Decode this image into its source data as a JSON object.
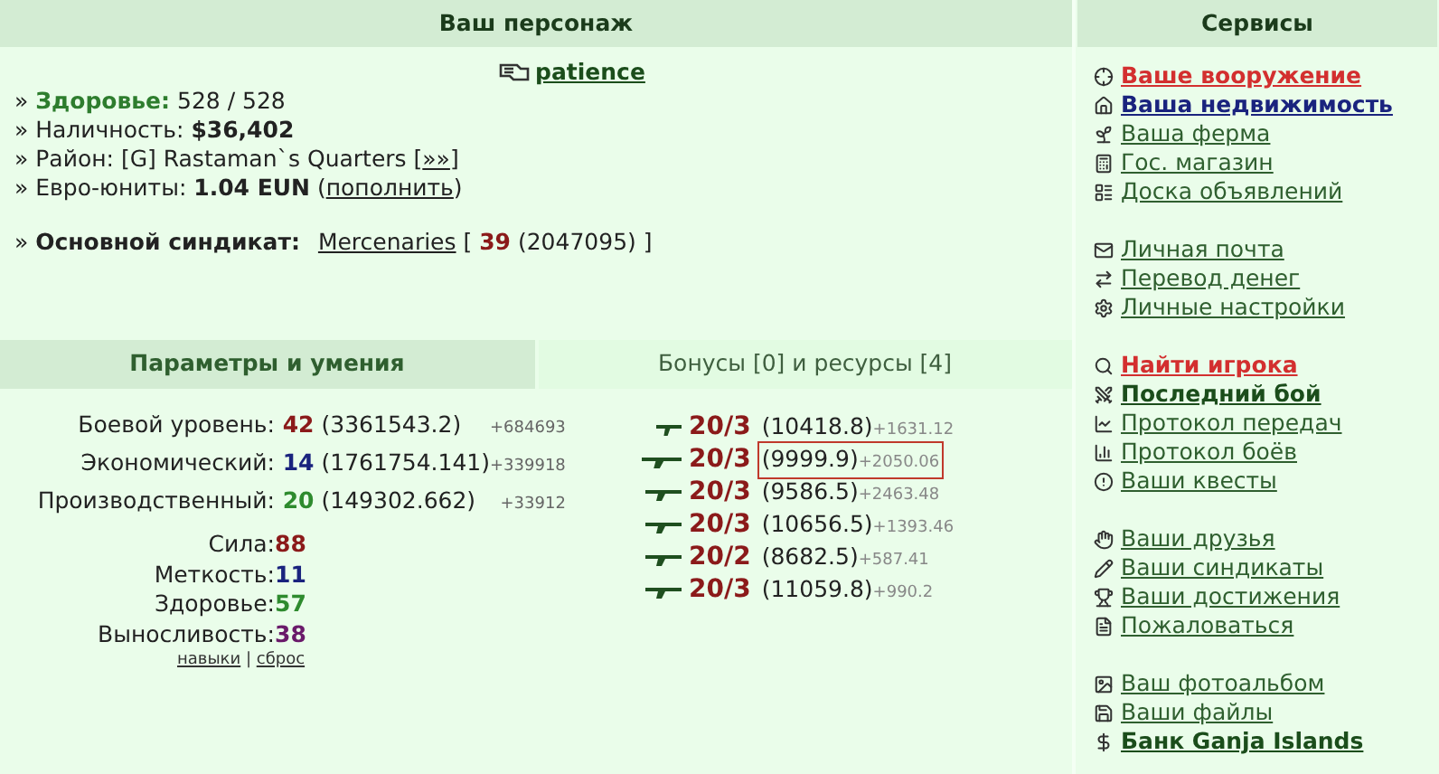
{
  "character": {
    "title": "Ваш персонаж",
    "name": "patience",
    "lines": [
      [
        {
          "text": "» "
        },
        {
          "text": "Здоровье:",
          "kind": "label"
        },
        {
          "text": " 528 / 528"
        }
      ],
      [
        {
          "text": "» Наличность: "
        },
        {
          "text": "$36,402",
          "kind": "bold"
        }
      ],
      [
        {
          "text": "» Район: [G] Rastaman`s Quarters ["
        },
        {
          "text": "»»",
          "kind": "link"
        },
        {
          "text": "]"
        }
      ],
      [
        {
          "text": "» Евро-юниты: "
        },
        {
          "text": "1.04 EUN",
          "kind": "bold"
        },
        {
          "text": " ("
        },
        {
          "text": "пополнить",
          "kind": "link"
        },
        {
          "text": ")"
        }
      ]
    ],
    "syndicate": [
      {
        "text": "» "
      },
      {
        "text": "Основной синдикат:",
        "kind": "bold"
      },
      {
        "text": "Mercenaries",
        "kind": "link"
      },
      {
        "text": " [ "
      },
      {
        "text": "39",
        "kind": "red"
      },
      {
        "text": " (2047095) ]"
      }
    ]
  },
  "tabs": [
    {
      "label": "Параметры и умения",
      "selected": true
    },
    {
      "label": "Бонусы [0] и ресурсы [4]",
      "selected": false
    }
  ],
  "skills": [
    {
      "label": "Боевой уровень:",
      "level": "42",
      "exp": "(3361543.2)",
      "gain": "+684693",
      "color": "#8b1a1a"
    },
    {
      "label": "Экономический:",
      "level": "14",
      "exp": "(1761754.141)",
      "gain": "+339918",
      "color": "#1a237e"
    },
    {
      "label": "Производственный:",
      "level": "20",
      "exp": "(149302.662)",
      "gain": "+33912",
      "color": "#2e8b2e"
    }
  ],
  "stats": [
    {
      "label": "Сила:",
      "value": "88",
      "color": "#8b1a1a"
    },
    {
      "label": "Меткость:",
      "value": "11",
      "color": "#1a237e"
    },
    {
      "label": "Здоровье:",
      "value": "57",
      "color": "#2e8b2e"
    },
    {
      "label": "Выносливость:",
      "value": "38",
      "color": "#6a1a6a"
    }
  ],
  "stat_links": [
    {
      "text": "навыки",
      "kind": "link"
    },
    {
      "text": " | "
    },
    {
      "text": "сброс",
      "kind": "link"
    }
  ],
  "weapons": [
    {
      "level": "20/3",
      "exp": "(10418.8)",
      "gain": "+1631.12",
      "highlighted": false
    },
    {
      "level": "20/3",
      "exp": "(9999.9)",
      "gain": "+2050.06",
      "highlighted": true
    },
    {
      "level": "20/3",
      "exp": "(9586.5)",
      "gain": "+2463.48",
      "highlighted": false
    },
    {
      "level": "20/3",
      "exp": "(10656.5)",
      "gain": "+1393.46",
      "highlighted": false
    },
    {
      "level": "20/2",
      "exp": "(8682.5)",
      "gain": "+587.41",
      "highlighted": false
    },
    {
      "level": "20/3",
      "exp": "(11059.8)",
      "gain": "+990.2",
      "highlighted": false
    }
  ],
  "services": {
    "title": "Сервисы",
    "groups": [
      [
        {
          "label": "Ваше вооружение",
          "kind": "alert"
        },
        {
          "label": "Ваша недвижимость",
          "kind": "strong"
        },
        {
          "label": "Ваша ферма",
          "kind": "normal"
        },
        {
          "label": "Гос. магазин",
          "kind": "normal"
        },
        {
          "label": "Доска объявлений",
          "kind": "normal"
        }
      ],
      [
        {
          "label": "Личная почта",
          "kind": "normal"
        },
        {
          "label": "Перевод денег",
          "kind": "normal"
        },
        {
          "label": "Личные настройки",
          "kind": "normal"
        }
      ],
      [
        {
          "label": "Найти игрока",
          "kind": "alert"
        },
        {
          "label": "Последний бой",
          "kind": "bold"
        },
        {
          "label": "Протокол передач",
          "kind": "normal"
        },
        {
          "label": "Протокол боёв",
          "kind": "normal"
        },
        {
          "label": "Ваши квесты",
          "kind": "normal"
        }
      ],
      [
        {
          "label": "Ваши друзья",
          "kind": "normal"
        },
        {
          "label": "Ваши синдикаты",
          "kind": "normal"
        },
        {
          "label": "Ваши достижения",
          "kind": "normal"
        },
        {
          "label": "Пожаловаться",
          "kind": "normal"
        }
      ],
      [
        {
          "label": "Ваш фотоальбом",
          "kind": "normal"
        },
        {
          "label": "Ваши файлы",
          "kind": "normal"
        },
        {
          "label": "Банк Ganja Islands",
          "kind": "bold"
        }
      ]
    ]
  }
}
